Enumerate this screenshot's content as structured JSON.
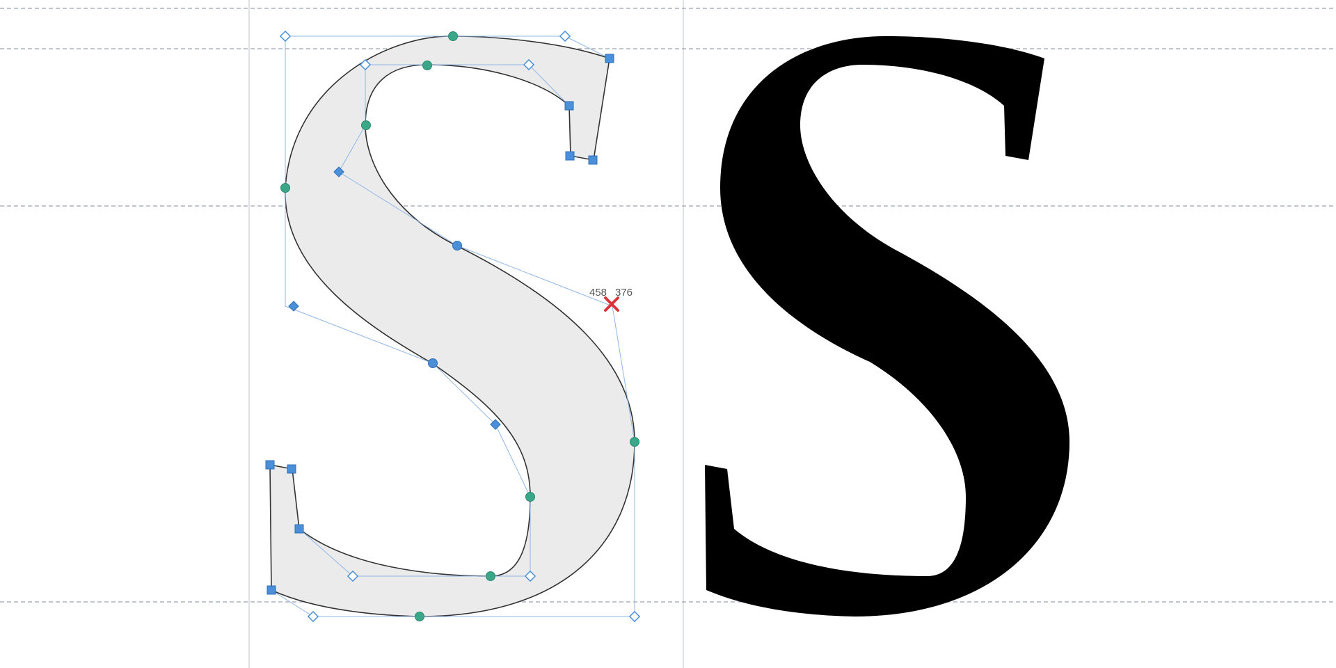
{
  "editor": {
    "cursor_readout": {
      "x": "458",
      "y": "376"
    },
    "colors": {
      "canvas_background": "#ffffff",
      "guide_line": "#9aa4b2",
      "sidebearing_line": "#c8cdd4",
      "outline_stroke": "#333333",
      "glyph_fill_edit": "#ebebeb",
      "glyph_fill_preview": "#000000",
      "handle_line": "#8fb6e6",
      "smooth_node": "#3aa789",
      "corner_node": "#4a8fd8",
      "offcurve_handle": "#4a8fd8",
      "cursor_marker": "#e0303a"
    },
    "icons": {
      "cursor": "x-cross-icon",
      "smooth_node": "circle-node-icon",
      "corner_node": "square-node-icon",
      "offcurve_handle": "diamond-handle-icon"
    }
  }
}
